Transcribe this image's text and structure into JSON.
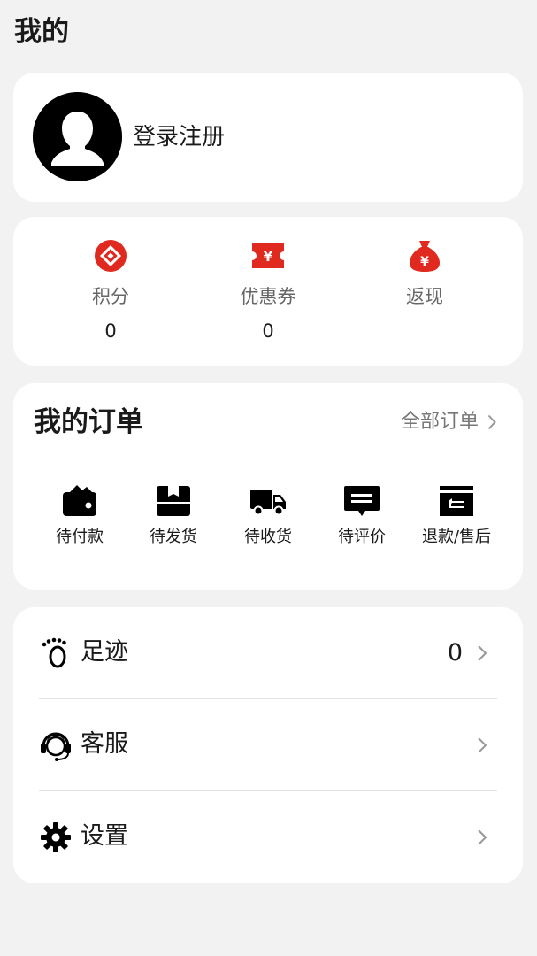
{
  "page": {
    "title": "我的"
  },
  "profile": {
    "login_label": "登录注册"
  },
  "assets": [
    {
      "label": "积分",
      "value": "0",
      "icon": "points-icon"
    },
    {
      "label": "优惠券",
      "value": "0",
      "icon": "coupon-icon"
    },
    {
      "label": "返现",
      "value": "",
      "icon": "cashback-bag-icon"
    }
  ],
  "orders": {
    "title": "我的订单",
    "all_label": "全部订单",
    "items": [
      {
        "label": "待付款",
        "icon": "wallet-icon"
      },
      {
        "label": "待发货",
        "icon": "package-icon"
      },
      {
        "label": "待收货",
        "icon": "truck-icon"
      },
      {
        "label": "待评价",
        "icon": "comment-icon"
      },
      {
        "label": "退款/售后",
        "icon": "refund-icon"
      }
    ]
  },
  "menu": {
    "items": [
      {
        "label": "足迹",
        "count": "0",
        "icon": "footprint-icon"
      },
      {
        "label": "客服",
        "count": "",
        "icon": "headset-icon"
      },
      {
        "label": "设置",
        "count": "",
        "icon": "gear-icon"
      }
    ]
  },
  "colors": {
    "accent": "#e0291f",
    "background": "#f2f2f2",
    "card": "#ffffff"
  }
}
